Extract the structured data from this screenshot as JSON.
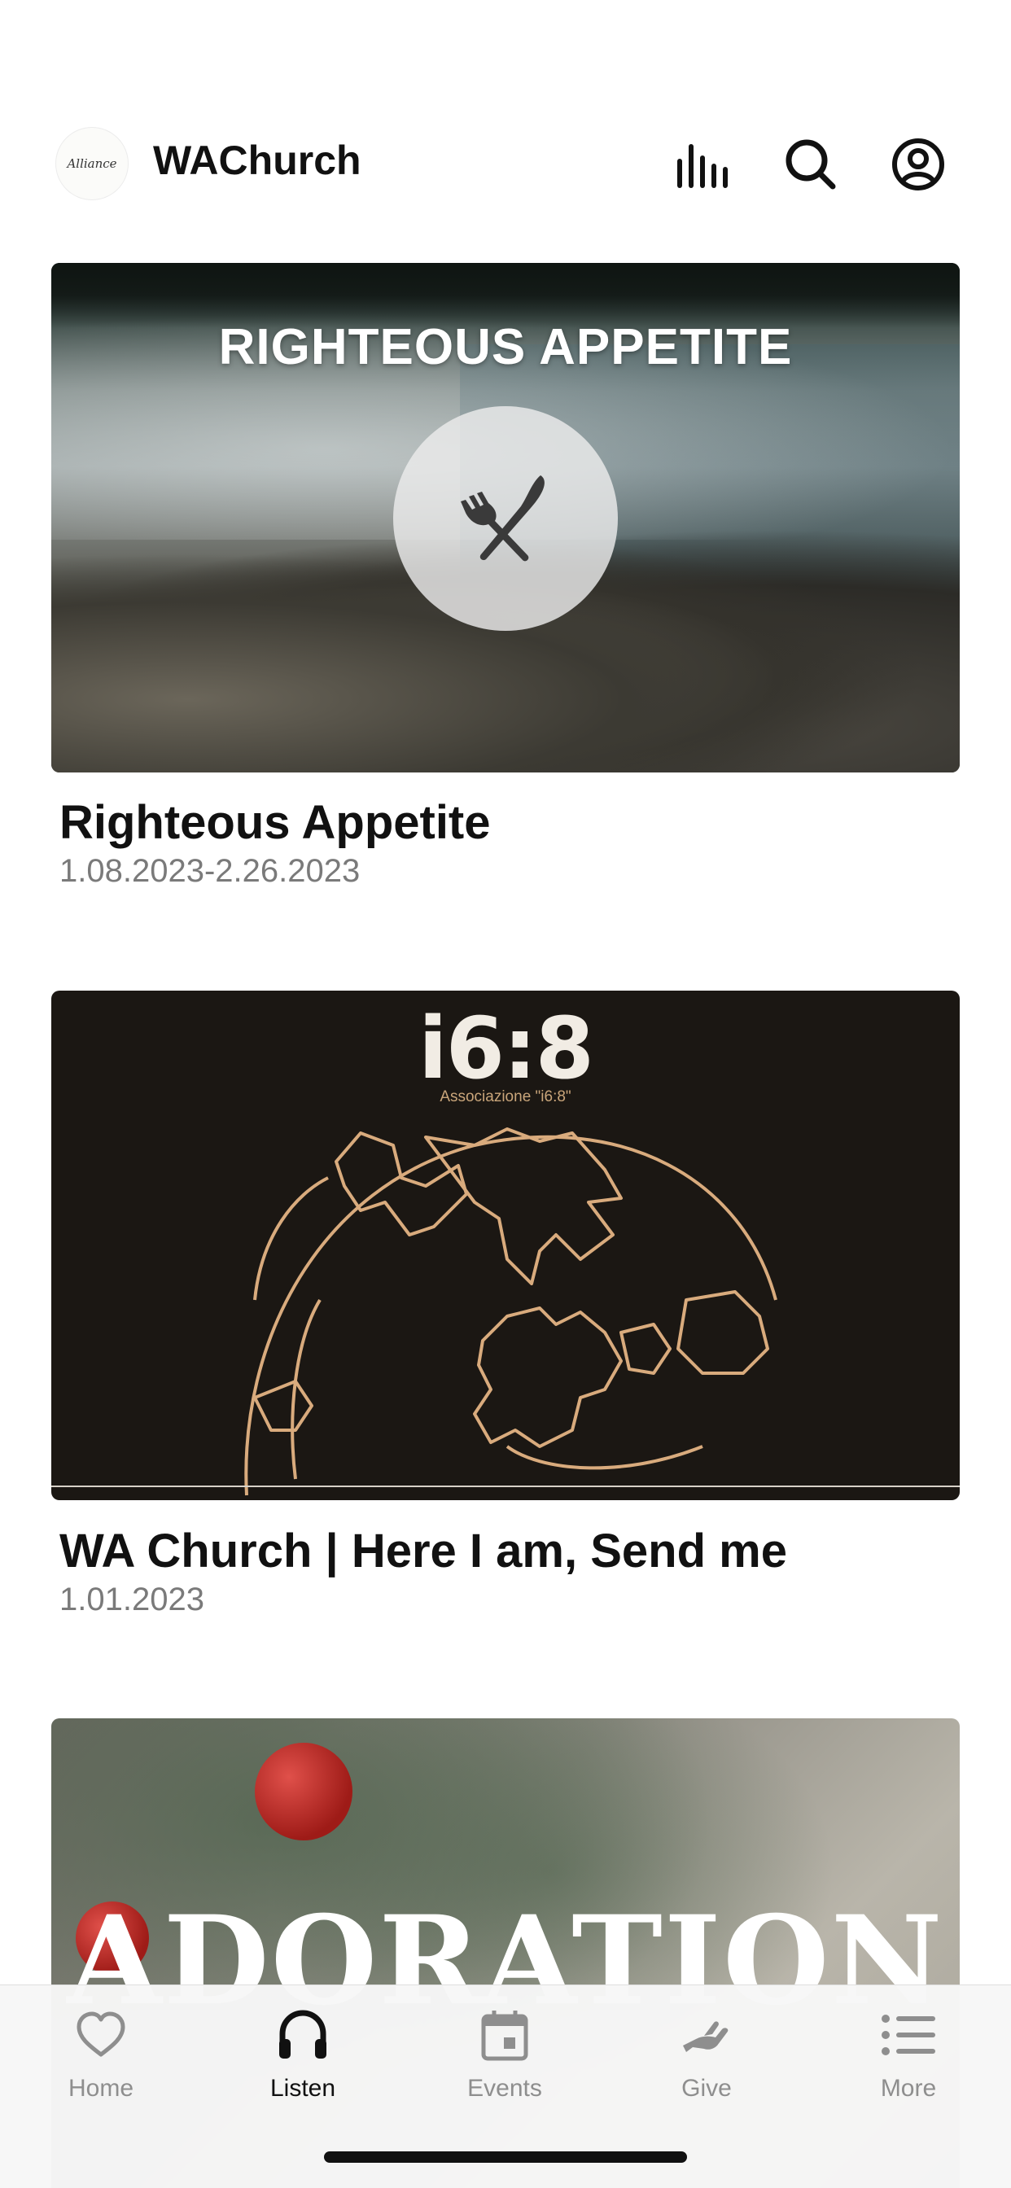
{
  "header": {
    "logo_text": "Alliance",
    "title": "WAChurch",
    "icons": [
      "equalizer-icon",
      "search-icon",
      "account-icon"
    ]
  },
  "cards": [
    {
      "image_heading": "RIGHTEOUS APPETITE",
      "image_icon": "fork-knife-icon",
      "title": "Righteous Appetite",
      "subtitle": "1.08.2023-2.26.2023"
    },
    {
      "image_brand": "i6:8",
      "image_brand_sub": "Associazione \"i6:8\"",
      "title": "WA Church | Here I am, Send me",
      "subtitle": "1.01.2023"
    },
    {
      "image_heading": "ADORATION"
    }
  ],
  "tabbar": {
    "active": "Listen",
    "tabs": [
      {
        "label": "Home",
        "icon": "heart-icon"
      },
      {
        "label": "Listen",
        "icon": "headphones-icon"
      },
      {
        "label": "Events",
        "icon": "calendar-icon"
      },
      {
        "label": "Give",
        "icon": "give-hand-icon"
      },
      {
        "label": "More",
        "icon": "list-icon"
      }
    ]
  },
  "colors": {
    "text_primary": "#111111",
    "text_secondary": "#7a7a7a",
    "tab_inactive": "#8e8e8e",
    "map_line": "#d9ab7d"
  }
}
